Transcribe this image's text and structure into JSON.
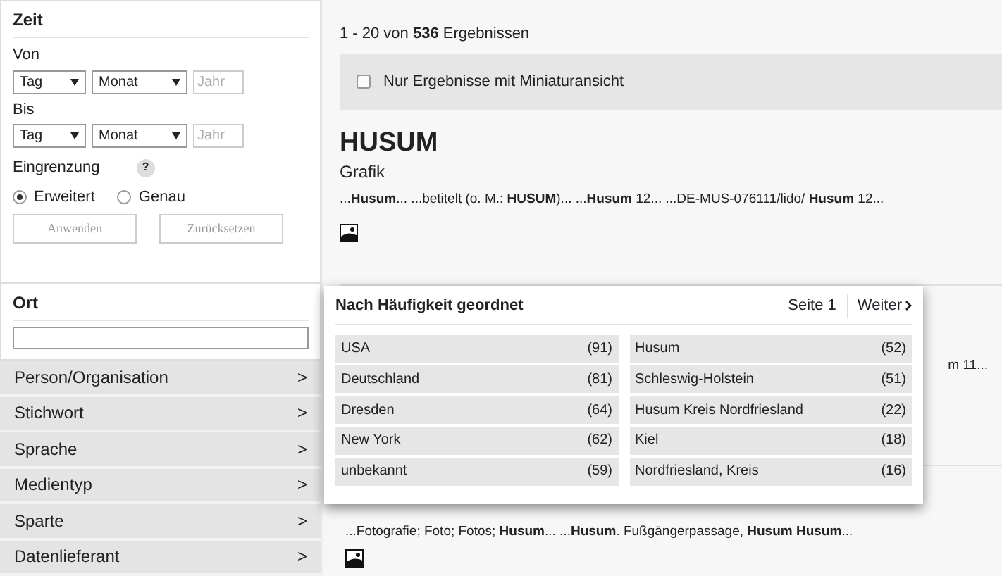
{
  "sidebar": {
    "time_panel": {
      "title": "Zeit",
      "ranges": [
        {
          "label": "Von",
          "day": "Tag",
          "month": "Monat",
          "year_placeholder": "Jahr"
        },
        {
          "label": "Bis",
          "day": "Tag",
          "month": "Monat",
          "year_placeholder": "Jahr"
        }
      ],
      "restriction_label": "Eingrenzung",
      "help": "?",
      "options": [
        {
          "label": "Erweitert",
          "selected": true
        },
        {
          "label": "Genau",
          "selected": false
        }
      ],
      "buttons": [
        {
          "label": "Anwenden",
          "disabled": true
        },
        {
          "label": "Zurücksetzen",
          "disabled": true
        }
      ]
    },
    "place_panel": {
      "title": "Ort"
    },
    "facets": [
      {
        "label": "Person/Organisation",
        "arrow": ">"
      },
      {
        "label": "Stichwort",
        "arrow": ">"
      },
      {
        "label": "Sprache",
        "arrow": ">"
      },
      {
        "label": "Medientyp",
        "arrow": ">"
      },
      {
        "label": "Sparte",
        "arrow": ">"
      },
      {
        "label": "Datenlieferant",
        "arrow": ">"
      }
    ]
  },
  "results": {
    "count": "1 - 20 von **536** Ergebnissen",
    "thumbnail_filter": {
      "label": "Nur Ergebnisse mit Miniaturansicht",
      "checked": false
    },
    "items": [
      {
        "title": "HUSUM",
        "type": "Grafik",
        "snippet": "...**Husum**... ...betitelt (o. M.: **HUSUM**)... ...**Husum** 12... ...DE-MUS-076111/lido/ **Husum** 12..."
      },
      {
        "snippet": "m 11..."
      },
      {
        "snippet": "...Fotografie; Foto; Fotos; **Husum**... ...**Husum**. Fußgängerpassage, **Husum Husum**..."
      }
    ]
  },
  "popup": {
    "title": "Nach Häufigkeit geordnet",
    "page": "Seite 1",
    "next": "Weiter",
    "columns": [
      [
        {
          "label": "USA",
          "count": "(91)"
        },
        {
          "label": "Deutschland",
          "count": "(81)"
        },
        {
          "label": "Dresden",
          "count": "(64)"
        },
        {
          "label": "New York",
          "count": "(62)"
        },
        {
          "label": "unbekannt",
          "count": "(59)"
        }
      ],
      [
        {
          "label": "Husum",
          "count": "(52)"
        },
        {
          "label": "Schleswig-Holstein",
          "count": "(51)"
        },
        {
          "label": "Husum Kreis Nordfriesland",
          "count": "(22)"
        },
        {
          "label": "Kiel",
          "count": "(18)"
        },
        {
          "label": "Nordfriesland, Kreis",
          "count": "(16)"
        }
      ]
    ]
  }
}
